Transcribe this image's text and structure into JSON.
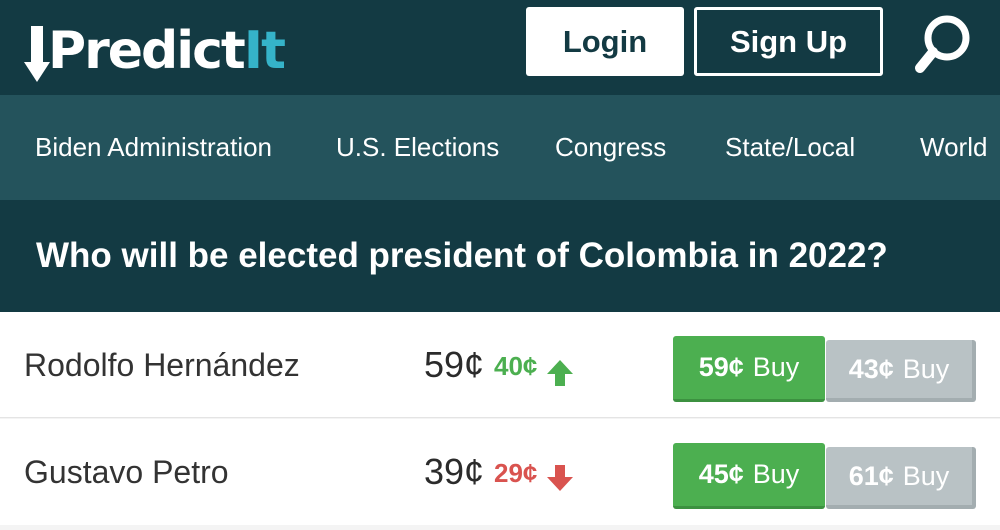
{
  "header": {
    "logo": {
      "part1": "Predict",
      "part2": "It"
    },
    "login_label": "Login",
    "signup_label": "Sign Up",
    "search_icon": "search-icon"
  },
  "nav": {
    "items": [
      {
        "label": "Biden Administration"
      },
      {
        "label": "U.S. Elections"
      },
      {
        "label": "Congress"
      },
      {
        "label": "State/Local"
      },
      {
        "label": "World"
      }
    ]
  },
  "market": {
    "question": "Who will be elected president of Colombia in 2022?"
  },
  "contracts": [
    {
      "name": "Rodolfo Hernández",
      "price": "59¢",
      "change": "40¢",
      "direction": "up",
      "buy_yes_price": "59¢",
      "buy_no_price": "43¢",
      "buy_label": "Buy"
    },
    {
      "name": "Gustavo Petro",
      "price": "39¢",
      "change": "29¢",
      "direction": "down",
      "buy_yes_price": "45¢",
      "buy_no_price": "61¢",
      "buy_label": "Buy"
    }
  ],
  "colors": {
    "header_bg": "#133a43",
    "nav_bg": "#24535c",
    "brand_accent": "#35b3c9",
    "up": "#4caf50",
    "down": "#d9534f",
    "buy_yes": "#4caf50",
    "buy_no": "#b9c2c5"
  }
}
